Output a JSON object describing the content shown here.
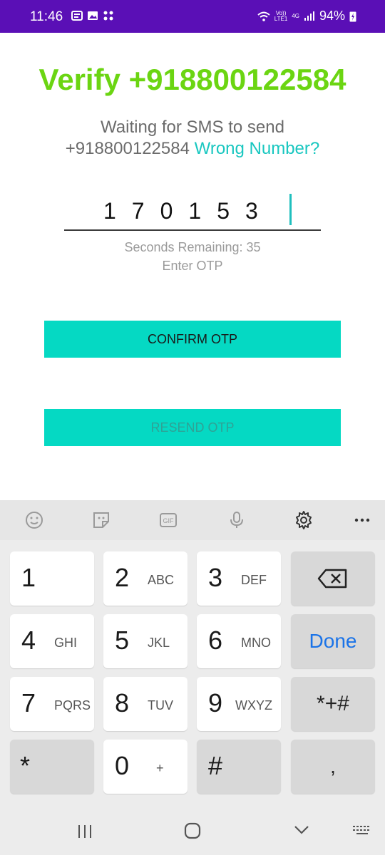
{
  "status": {
    "time": "11:46",
    "network_top": "Vo))",
    "network_bottom": "LTE1",
    "generation": "4G",
    "battery": "94%"
  },
  "page": {
    "title": "Verify +918800122584",
    "waiting_line1": "Waiting for SMS to send",
    "phone": "+918800122584",
    "wrong_number": "Wrong Number?",
    "otp_value": "170153",
    "seconds_remaining": "Seconds Remaining: 35",
    "enter_otp": "Enter OTP",
    "confirm_label": "CONFIRM OTP",
    "resend_label": "RESEND OTP"
  },
  "keyboard": {
    "toolbar": {
      "gif_label": "GIF"
    },
    "keys": [
      {
        "num": "1",
        "letters": ""
      },
      {
        "num": "2",
        "letters": "ABC"
      },
      {
        "num": "3",
        "letters": "DEF"
      },
      {
        "num": "4",
        "letters": "GHI"
      },
      {
        "num": "5",
        "letters": "JKL"
      },
      {
        "num": "6",
        "letters": "MNO"
      },
      {
        "num": "7",
        "letters": "PQRS"
      },
      {
        "num": "8",
        "letters": "TUV"
      },
      {
        "num": "9",
        "letters": "WXYZ"
      },
      {
        "num": "0",
        "letters": "+"
      }
    ],
    "done_label": "Done",
    "symbols_label": "*+#",
    "star_label": "*",
    "hash_label": "#",
    "comma_label": ","
  },
  "colors": {
    "status_bar": "#5a0fb6",
    "title_green": "#6bd512",
    "accent_teal": "#05d9c3",
    "link_teal": "#18c7c0",
    "done_blue": "#1a73e8"
  }
}
